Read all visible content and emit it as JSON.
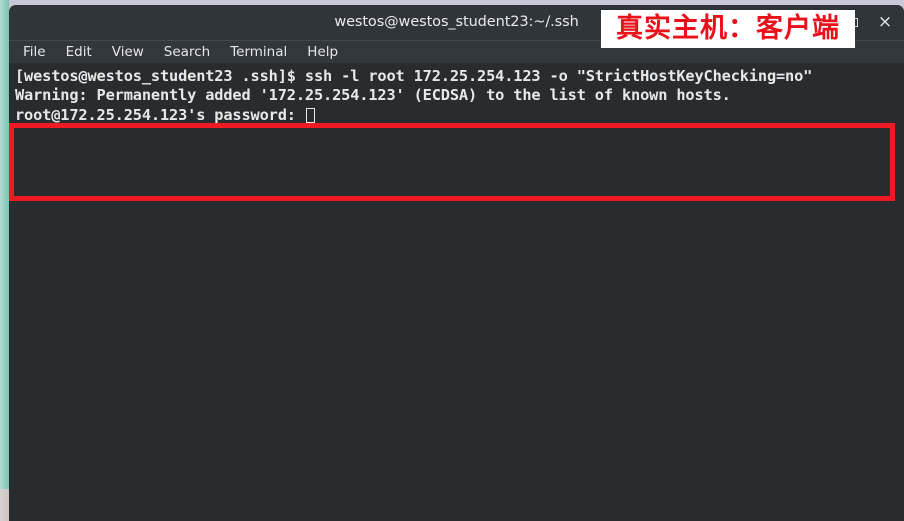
{
  "window": {
    "title": "westos@westos_student23:~/.ssh",
    "controls": {
      "maximize_label": "",
      "close_label": "×"
    }
  },
  "menubar": {
    "items": [
      {
        "label": "File"
      },
      {
        "label": "Edit"
      },
      {
        "label": "View"
      },
      {
        "label": "Search"
      },
      {
        "label": "Terminal"
      },
      {
        "label": "Help"
      }
    ]
  },
  "terminal": {
    "lines": [
      {
        "text": "[westos@westos_student23 .ssh]$ ssh -l root 172.25.254.123 -o \"StrictHostKeyChecking=no\""
      },
      {
        "text": "Warning: Permanently added '172.25.254.123' (ECDSA) to the list of known hosts."
      },
      {
        "text": "root@172.25.254.123's password: "
      }
    ],
    "cursor": "block-outline"
  },
  "annotation": {
    "text": "真实主机：客户端",
    "color": "#e8121a",
    "background": "#ffffff"
  },
  "highlight": {
    "color": "#ee1b24"
  },
  "colors": {
    "terminal_background": "#282c2e",
    "titlebar_background": "#30353a",
    "menubar_background": "#32373c",
    "text": "#e8e8e8",
    "desktop_background": "#c9c8d8",
    "accent_strip": "#8ecfc2"
  }
}
